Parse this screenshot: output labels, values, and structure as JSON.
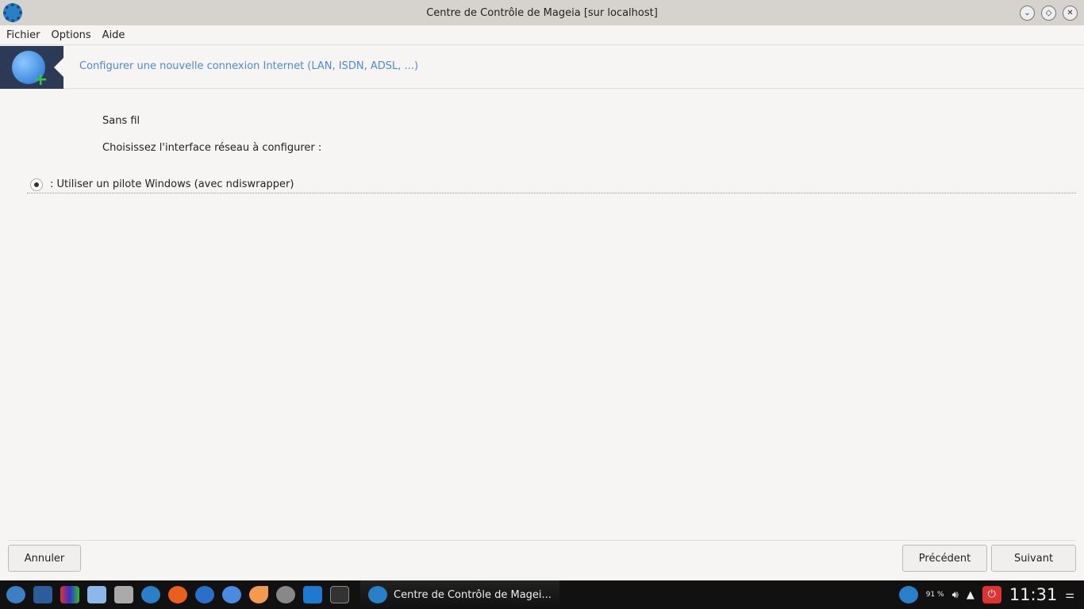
{
  "window": {
    "title": "Centre de Contrôle de Mageia [sur localhost]"
  },
  "menu": [
    "Fichier",
    "Options",
    "Aide"
  ],
  "banner": {
    "title": "Configurer une nouvelle connexion Internet (LAN, ISDN, ADSL, ...)"
  },
  "content": {
    "heading": "Sans fil",
    "prompt": "Choisissez l'interface réseau à configurer :",
    "options": [
      {
        "label": ": Utiliser un pilote Windows (avec ndiswrapper)",
        "selected": true
      }
    ]
  },
  "buttons": {
    "cancel": "Annuler",
    "previous": "Précédent",
    "next": "Suivant"
  },
  "taskbar": {
    "task": "Centre de Contrôle de Magei...",
    "battery": "91 %",
    "clock": "11:31"
  },
  "colors": {
    "accent": "#4d8ae0",
    "banner_bg": "#2d3a55"
  }
}
